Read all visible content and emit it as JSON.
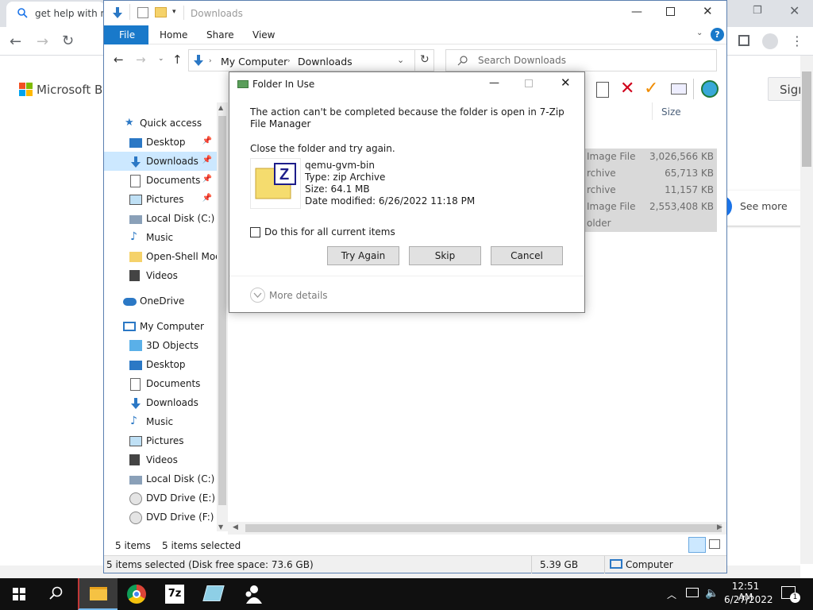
{
  "chrome": {
    "tab_title": "get help with no",
    "bing_brand": "Microsoft Bin",
    "sign_label": "Sigr",
    "see_more": "See more"
  },
  "explorer": {
    "title": "Downloads",
    "ribbon": {
      "file": "File",
      "home": "Home",
      "share": "Share",
      "view": "View"
    },
    "breadcrumb": [
      "My Computer",
      "Downloads"
    ],
    "search_placeholder": "Search Downloads",
    "nav": {
      "quick_access": "Quick access",
      "quick_items": [
        "Desktop",
        "Downloads",
        "Documents",
        "Pictures",
        "Local Disk (C:)",
        "Music",
        "Open-Shell Mod",
        "Videos"
      ],
      "onedrive": "OneDrive",
      "my_computer": "My Computer",
      "computer_items": [
        "3D Objects",
        "Desktop",
        "Documents",
        "Downloads",
        "Music",
        "Pictures",
        "Videos",
        "Local Disk (C:)",
        "DVD Drive (E:) d-",
        "DVD Drive (F:) H"
      ]
    },
    "list": {
      "size_header": "Size",
      "rows": [
        {
          "type": "Image File",
          "size": "3,026,566 KB"
        },
        {
          "type": "rchive",
          "size": "65,713 KB"
        },
        {
          "type": "rchive",
          "size": "11,157 KB"
        },
        {
          "type": "Image File",
          "size": "2,553,408 KB"
        },
        {
          "type": "older",
          "size": ""
        }
      ]
    },
    "status": {
      "items_count": "5 items",
      "items_selected": "5 items selected",
      "bottom_left": "5 items selected (Disk free space: 73.6 GB)",
      "bottom_size": "5.39 GB",
      "bottom_location": "Computer"
    }
  },
  "dialog": {
    "title": "Folder In Use",
    "message": "The action can't be completed because the folder is open in 7-Zip File Manager",
    "instruction": "Close the folder and try again.",
    "file_name": "qemu-gvm-bin",
    "file_type": "Type: zip Archive",
    "file_size": "Size: 64.1 MB",
    "file_modified": "Date modified: 6/26/2022 11:18 PM",
    "checkbox_label": "Do this for all current items",
    "buttons": {
      "try_again": "Try Again",
      "skip": "Skip",
      "cancel": "Cancel"
    },
    "more_details": "More details"
  },
  "taskbar": {
    "time": "12:51 AM",
    "date": "6/27/2022",
    "notification_count": "1",
    "sevenzip_label": "7z"
  },
  "colors": {
    "accent": "#1979ca",
    "selection": "#cce8ff",
    "taskbar": "#101010"
  }
}
